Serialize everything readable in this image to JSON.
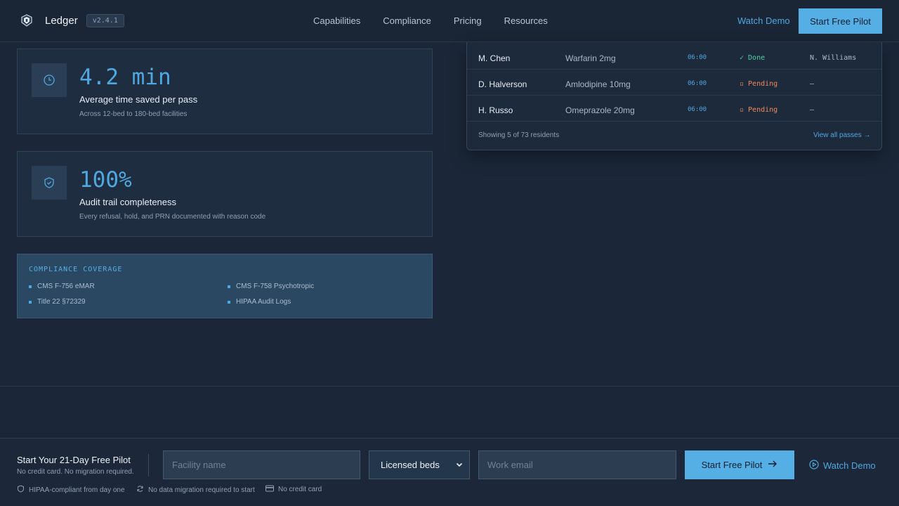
{
  "header": {
    "brand_name": "Ledger",
    "version": "v2.4.1",
    "nav": [
      "Capabilities",
      "Compliance",
      "Pricing",
      "Resources"
    ],
    "watch_demo": "Watch Demo",
    "start_pilot": "Start Free Pilot"
  },
  "metrics": [
    {
      "icon": "clock-icon",
      "value": "4.2 min",
      "title": "Average time saved per pass",
      "subtitle": "Across 12-bed to 180-bed facilities"
    },
    {
      "icon": "shield-check-icon",
      "value": "100%",
      "title": "Audit trail completeness",
      "subtitle": "Every refusal, hold, and PRN documented with reason code"
    }
  ],
  "compliance": {
    "title": "COMPLIANCE COVERAGE",
    "items": [
      "CMS F-756 eMAR",
      "CMS F-758 Psychotropic",
      "Title 22 §72329",
      "HIPAA Audit Logs"
    ]
  },
  "med_pass_table": {
    "rows": [
      {
        "resident": "M. Chen",
        "medication": "Warfarin 2mg",
        "time": "06:00",
        "status": "✓ Done",
        "status_type": "done",
        "administered_by": "N. Williams"
      },
      {
        "resident": "D. Halverson",
        "medication": "Amlodipine 10mg",
        "time": "06:00",
        "status": "▫ Pending",
        "status_type": "pending",
        "administered_by": "—"
      },
      {
        "resident": "H. Russo",
        "medication": "Omeprazole 20mg",
        "time": "06:00",
        "status": "▫ Pending",
        "status_type": "pending",
        "administered_by": "—"
      }
    ],
    "footer": "Showing 5 of 73 residents",
    "view_all": "View all passes →"
  },
  "cta": {
    "title": "Start Your 21-Day Free Pilot",
    "subtitle": "No credit card. No migration required.",
    "facility_placeholder": "Facility name",
    "beds_selected": "Licensed beds",
    "email_placeholder": "Work email",
    "start_pilot": "Start Free Pilot",
    "watch_demo": "Watch Demo",
    "trust": [
      {
        "icon": "shield-icon",
        "label": "HIPAA-compliant from day one"
      },
      {
        "icon": "refresh-icon",
        "label": "No data migration required to start"
      },
      {
        "icon": "credit-card-icon",
        "label": "No credit card"
      }
    ]
  },
  "colors": {
    "accent": "#55aee4",
    "background": "#1b2738",
    "done": "#4fd1a5",
    "pending": "#ef8a5a"
  }
}
